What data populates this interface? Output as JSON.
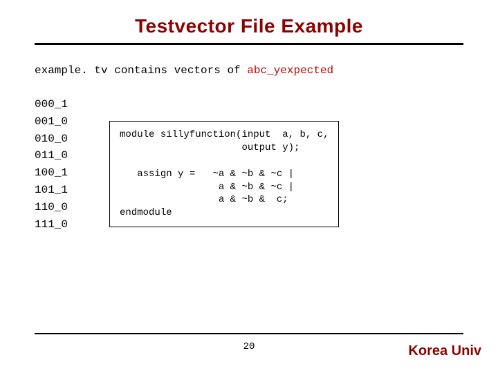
{
  "title": "Testvector File Example",
  "intro": {
    "prefix": "example. tv contains vectors of ",
    "highlight": "abc_yexpected"
  },
  "vectors": [
    "000_1",
    "001_0",
    "010_0",
    "011_0",
    "100_1",
    "101_1",
    "110_0",
    "111_0"
  ],
  "code": {
    "l1": "module sillyfunction(input  a, b, c,",
    "l2": "                     output y);",
    "l3": "",
    "l4": "   assign y =   ~a & ~b & ~c |",
    "l5": "                 a & ~b & ~c |",
    "l6": "                 a & ~b &  c;",
    "l7": "endmodule"
  },
  "page_number": "20",
  "brand": "Korea Univ"
}
